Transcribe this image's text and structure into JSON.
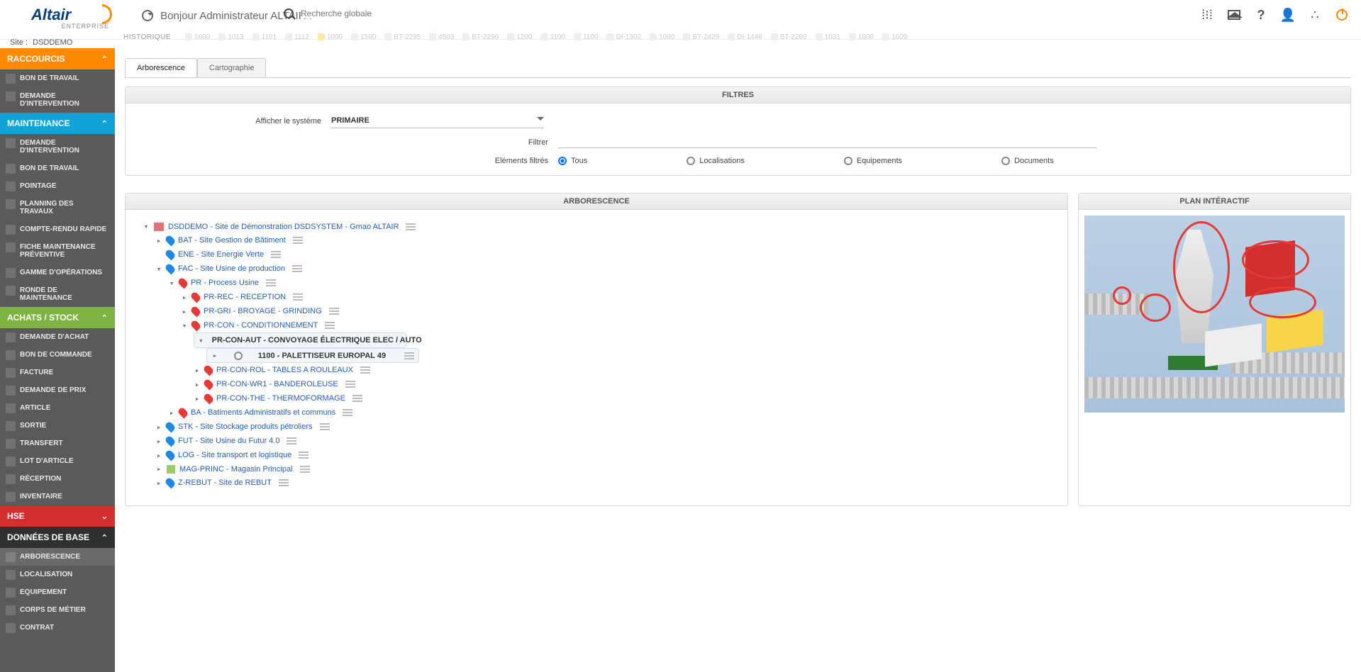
{
  "brand": {
    "name": "Altair",
    "sub": "ENTERPRISE"
  },
  "topbar": {
    "greeting": "Bonjour Administrateur ALTAIR !",
    "search_placeholder": "Recherche globale",
    "site_prefix": "Site :",
    "site": "DSDDEMO",
    "history_label": "HISTORIQUE",
    "history": [
      "1000",
      "1013",
      "1101",
      "1112",
      "1000",
      "1500",
      "BT-2295",
      "4503",
      "BT-2296",
      "1200",
      "1100",
      "1100",
      "DI-1302",
      "1000",
      "BT-2429",
      "DI-1446",
      "BT-2260",
      "1031",
      "1000",
      "1609"
    ],
    "history_yellow_index": 4,
    "icons": [
      "stats-icon",
      "home-icon",
      "help-icon",
      "user-icon",
      "share-icon",
      "power-icon"
    ]
  },
  "sidebar": {
    "sections": [
      {
        "label": "RACCOURCIS",
        "color": "orange",
        "open": true,
        "items": [
          "BON DE TRAVAIL",
          "DEMANDE D'INTERVENTION"
        ]
      },
      {
        "label": "MAINTENANCE",
        "color": "blue",
        "open": true,
        "items": [
          "DEMANDE D'INTERVENTION",
          "BON DE TRAVAIL",
          "POINTAGE",
          "PLANNING DES TRAVAUX",
          "COMPTE-RENDU RAPIDE",
          "FICHE MAINTENANCE PRÉVENTIVE",
          "GAMME D'OPÉRATIONS",
          "RONDE DE MAINTENANCE"
        ]
      },
      {
        "label": "ACHATS / STOCK",
        "color": "green",
        "open": true,
        "items": [
          "DEMANDE D'ACHAT",
          "BON DE COMMANDE",
          "FACTURE",
          "DEMANDE DE PRIX",
          "ARTICLE",
          "SORTIE",
          "TRANSFERT",
          "LOT D'ARTICLE",
          "RÉCEPTION",
          "INVENTAIRE"
        ]
      },
      {
        "label": "HSE",
        "color": "red",
        "open": false,
        "items": []
      },
      {
        "label": "DONNÉES DE BASE",
        "color": "dark",
        "open": true,
        "items": [
          "ARBORESCENCE",
          "LOCALISATION",
          "EQUIPEMENT",
          "CORPS DE MÉTIER",
          "CONTRAT"
        ],
        "active_item": 0
      }
    ]
  },
  "tabs": {
    "items": [
      "Arborescence",
      "Cartographie"
    ],
    "active": 0
  },
  "filters": {
    "title": "FILTRES",
    "system_label": "Afficher le système",
    "system_value": "PRIMAIRE",
    "filter_label": "Filtrer",
    "filter_value": "",
    "filtered_label": "Eléments filtrés",
    "radios": [
      "Tous",
      "Localisations",
      "Equipements",
      "Documents"
    ],
    "radio_checked": 0
  },
  "tree": {
    "title": "ARBORESCENCE",
    "root": "DSDDEMO - Site de Démonstration DSDSYSTEM - Gmao ALTAIR",
    "nodes": [
      {
        "l": 1,
        "st": ">",
        "pin": "blue",
        "t": "BAT - Site Gestion de Bâtiment"
      },
      {
        "l": 1,
        "st": "",
        "pin": "blue",
        "t": "ENE - Site Energie Verte"
      },
      {
        "l": 1,
        "st": "v",
        "pin": "blue",
        "t": "FAC - Site Usine de production"
      },
      {
        "l": 2,
        "st": "v",
        "pin": "red",
        "t": "PR - Process Usine"
      },
      {
        "l": 3,
        "st": ">",
        "pin": "red",
        "t": "PR-REC - RECEPTION"
      },
      {
        "l": 3,
        "st": ">",
        "pin": "red",
        "t": "PR-GRI - BROYAGE - GRINDING"
      },
      {
        "l": 3,
        "st": "v",
        "pin": "red",
        "t": "PR-CON - CONDITIONNEMENT"
      },
      {
        "l": 4,
        "st": "v",
        "pin": "red",
        "t": "PR-CON-AUT - CONVOYAGE ÉLECTRIQUE ELEC / AUTO",
        "sel": true
      },
      {
        "l": 5,
        "st": ">",
        "gear": true,
        "t": "1100 - PALETTISEUR EUROPAL 49",
        "sel": true
      },
      {
        "l": 4,
        "st": ">",
        "pin": "red",
        "t": "PR-CON-ROL - TABLES A ROULEAUX"
      },
      {
        "l": 4,
        "st": ">",
        "pin": "red",
        "t": "PR-CON-WR1 - BANDEROLEUSE"
      },
      {
        "l": 4,
        "st": ">",
        "pin": "red",
        "t": "PR-CON-THE - THERMOFORMAGE"
      },
      {
        "l": 2,
        "st": ">",
        "pin": "red",
        "t": "BA - Batiments Administratifs et communs"
      },
      {
        "l": 1,
        "st": ">",
        "pin": "blue",
        "t": "STK - Site Stockage produits pétroliers"
      },
      {
        "l": 1,
        "st": ">",
        "pin": "blue",
        "t": "FUT - Site Usine du Futur 4.0"
      },
      {
        "l": 1,
        "st": ">",
        "pin": "blue",
        "t": "LOG - Site transport et logistique"
      },
      {
        "l": 1,
        "st": ">",
        "pin": "",
        "t": "MAG-PRINC - Magasin Principal"
      },
      {
        "l": 1,
        "st": ">",
        "pin": "blue",
        "t": "Z-REBUT - Site de REBUT"
      }
    ]
  },
  "plan": {
    "title": "PLAN INTÉRACTIF"
  }
}
